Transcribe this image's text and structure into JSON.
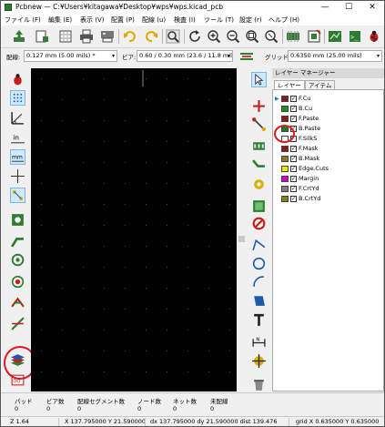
{
  "window": {
    "title": "Pcbnew — C:¥Users¥kitagawa¥Desktop¥wps¥wps.kicad_pcb",
    "minimize": "—",
    "maximize": "☐",
    "close": "✕"
  },
  "menu": [
    "ファイル (F)",
    "編集 (E)",
    "表示 (V)",
    "配置 (P)",
    "配線 (u)",
    "検査 (I)",
    "ツール (T)",
    "設定 (r)",
    "ヘルプ (H)"
  ],
  "toolbar2": {
    "track_label": "配線:",
    "track_value": "0.127 mm (5.00 mils) *",
    "via_label": "ビア:",
    "via_value": "0.60 / 0.30 mm (23.6 / 11.8 mils) *",
    "grid_label": "グリッド:",
    "grid_value": "0.6350 mm (25.00 mils)"
  },
  "layer_manager": {
    "title": "レイヤー マネージャー",
    "tabs": [
      "レイヤー",
      "アイテム"
    ],
    "layers": [
      {
        "name": "F.Cu",
        "color": "#8b1a1a",
        "checked": true,
        "active": true
      },
      {
        "name": "B.Cu",
        "color": "#1f8f1f",
        "checked": true,
        "active": false
      },
      {
        "name": "F.Paste",
        "color": "#8b1a1a",
        "checked": true,
        "active": false
      },
      {
        "name": "B.Paste",
        "color": "#1f7a2c",
        "checked": true,
        "active": false
      },
      {
        "name": "F.SilkS",
        "color": "#ffffff",
        "checked": false,
        "active": false
      },
      {
        "name": "F.Mask",
        "color": "#8b1a1a",
        "checked": true,
        "active": false
      },
      {
        "name": "B.Mask",
        "color": "#8a7b2a",
        "checked": true,
        "active": false
      },
      {
        "name": "Edge.Cuts",
        "color": "#e8e800",
        "checked": true,
        "active": false
      },
      {
        "name": "Margin",
        "color": "#d000d0",
        "checked": true,
        "active": false
      },
      {
        "name": "F.CrtYd",
        "color": "#808080",
        "checked": true,
        "active": false
      },
      {
        "name": "B.CrtYd",
        "color": "#808020",
        "checked": true,
        "active": false
      }
    ]
  },
  "message_panel": {
    "columns": [
      {
        "label": "パッド",
        "value": "0"
      },
      {
        "label": "ビア数",
        "value": "0"
      },
      {
        "label": "配線セグメント数",
        "value": "0"
      },
      {
        "label": "ノード数",
        "value": "0"
      },
      {
        "label": "ネット数",
        "value": "0"
      },
      {
        "label": "未配線",
        "value": "0"
      }
    ]
  },
  "status": {
    "zoom": "Z 1.64",
    "xy": "X 137.795000  Y 21.590000",
    "dxy": "dx 137.795000  dy 21.590000  dist 139.476",
    "grid": "grid X 0.635000  Y 0.635000"
  },
  "colors": {
    "canvas": "#000000",
    "highlight": "#e0191f",
    "active_bg": "#cde8ff"
  }
}
